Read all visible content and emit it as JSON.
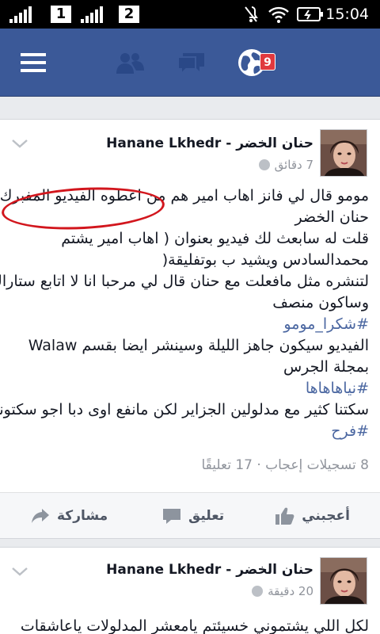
{
  "status_bar": {
    "sim1": "1",
    "sim2": "2",
    "time": "15:04"
  },
  "nav": {
    "notifications_badge": "9",
    "icons": [
      "menu-icon",
      "friend-requests-icon",
      "messages-icon",
      "notifications-globe-icon"
    ]
  },
  "posts": [
    {
      "author": "Hanane Lkhedr - حنان الخضر",
      "time": "7 دقائق",
      "lines": [
        "مومو قال لي فانز اهاب امير هم من اعطوه الفيديو المفبرك ل",
        "حنان الخضر",
        "قلت له سابعث لك فيديو بعنوان ( اهاب امير يشتم",
        "محمدالسادس ويشيد ب بوتفليقة(",
        "لتنشره مثل مافعلت مع حنان قال لي مرحبا انا لا اتابع ستاراك",
        "وساكون منصف",
        "#شكرا_مومو",
        "الفيديو سيكون جاهز الليلة وسينشر ايضا بقسم Walaw",
        "بمجلة الجرس",
        "#نياهاهاها",
        "سكتنا كثير مع مدلولين الجزاير لكن مانفع اوى دبا اجو سكتوني",
        "#فرح"
      ],
      "stats": "8 تسجيلات إعجاب · 17 تعليقًا",
      "actions": {
        "like": "أعجبني",
        "comment": "تعليق",
        "share": "مشاركة"
      }
    },
    {
      "author": "Hanane Lkhedr - حنان الخضر",
      "time": "20 دقيقة",
      "lines": [
        "لكل اللي يشتموني خسيئتم يامعشر المدلولات ياعاشقات"
      ]
    }
  ],
  "colors": {
    "nav": "#3b5998",
    "badge": "#e0393e",
    "hashtag": "#4b67a1",
    "annotation": "#d2161d"
  }
}
